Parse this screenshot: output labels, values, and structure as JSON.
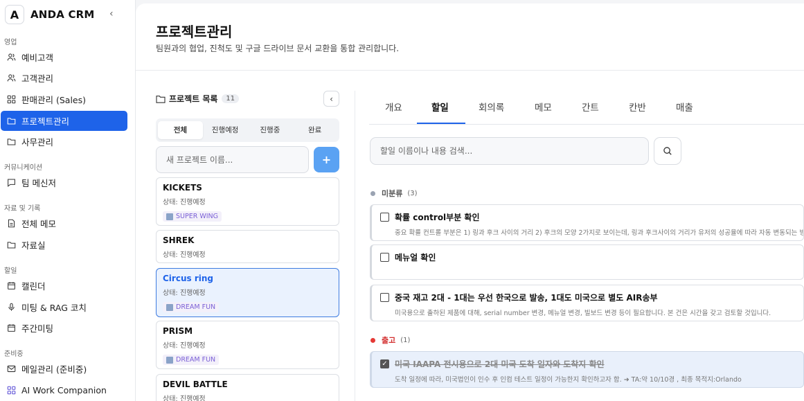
{
  "sidebar": {
    "brand_letter": "A",
    "brand_name": "ANDA CRM",
    "collapse_glyph": "‹",
    "sections": [
      {
        "label": "영업",
        "items": [
          {
            "label": "예비고객",
            "icon": "users-icon"
          },
          {
            "label": "고객관리",
            "icon": "users-icon"
          },
          {
            "label": "판매관리 (Sales)",
            "icon": "grid-icon"
          },
          {
            "label": "프로젝트관리",
            "icon": "folder-icon",
            "active": true
          },
          {
            "label": "사무관리",
            "icon": "folder-icon"
          }
        ]
      },
      {
        "label": "커뮤니케이션",
        "items": [
          {
            "label": "팀 메신저",
            "icon": "chat-icon"
          }
        ]
      },
      {
        "label": "자료 및 기록",
        "items": [
          {
            "label": "전체 메모",
            "icon": "document-icon"
          },
          {
            "label": "자료실",
            "icon": "folder-icon"
          }
        ]
      },
      {
        "label": "할일",
        "items": [
          {
            "label": "캘린더",
            "icon": "calendar-icon"
          },
          {
            "label": "미팅 & RAG 코치",
            "icon": "mic-icon"
          },
          {
            "label": "주간미팅",
            "icon": "calendar-icon"
          }
        ]
      },
      {
        "label": "준비중",
        "items": [
          {
            "label": "메일관리 (준비중)",
            "icon": "mail-icon"
          },
          {
            "label": "AI Work Companion",
            "icon": "grid-icon"
          }
        ]
      }
    ]
  },
  "header": {
    "title": "프로젝트관리",
    "subtitle": "팀원과의 협업, 진척도 및 구글 드라이브 문서 교환을 통합 관리합니다."
  },
  "project_list": {
    "title": "프로젝트 목록",
    "count": "11",
    "filters": [
      "전체",
      "진행예정",
      "진행중",
      "완료"
    ],
    "active_filter": 0,
    "new_placeholder": "새 프로젝트 이름...",
    "add_label": "+",
    "projects": [
      {
        "name": "KICKETS",
        "status": "상태: 진행예정",
        "tag": "SUPER WING"
      },
      {
        "name": "SHREK",
        "status": "상태: 진행예정",
        "tag": ""
      },
      {
        "name": "Circus ring",
        "status": "상태: 진행예정",
        "tag": "DREAM FUN",
        "selected": true
      },
      {
        "name": "PRISM",
        "status": "상태: 진행예정",
        "tag": "DREAM FUN"
      },
      {
        "name": "DEVIL BATTLE",
        "status": "상태: 진행예정",
        "tag": ""
      }
    ]
  },
  "detail_tabs": [
    "개요",
    "할일",
    "회의록",
    "메모",
    "간트",
    "칸반",
    "매출"
  ],
  "active_tab": 1,
  "search": {
    "placeholder": "할일 이름이나 내용 검색..."
  },
  "groups": [
    {
      "name": "미분류",
      "count": "(3)",
      "color": "#9aa3b2",
      "title_color": "#555"
    },
    {
      "name": "출고",
      "count": "(1)",
      "color": "#e53935",
      "title_color": "#d32f2f"
    }
  ],
  "todos": [
    {
      "title": "확률 control부분 확인",
      "desc": "중요 확률 컨트롤 부분은 1) 링과 후크 사이의 거리 2) 후크의 모양 2가지로 보이는데, 링과 후크사이의 거리가 유저의 성공율에 따라 자동 변동되는 방식으로",
      "done": false
    },
    {
      "title": "메뉴얼 확인",
      "desc": "",
      "done": false
    },
    {
      "title": "중국 재고 2대 - 1대는 우선 한국으로 발송, 1대도 미국으로 별도 AIR송부",
      "desc": "미국용으로 출하된 제품에 대해, serial number 변경, 메뉴얼 변경, 빌보드 변경 등이 필요합니다. 본 건은 시간을 갖고 검토할 것입니다.",
      "done": false
    },
    {
      "title": "미국 IAAPA 전시용으로 2대 미국 도착 일자와 도착지 확인",
      "desc": "도착 일정에 따라, 미국법인이 인수 후 인컴 테스트 일정이 가능한지 확인하고자 함. ➜ TA:약 10/10경 , 최종 목적지:Orlando",
      "done": true
    }
  ]
}
